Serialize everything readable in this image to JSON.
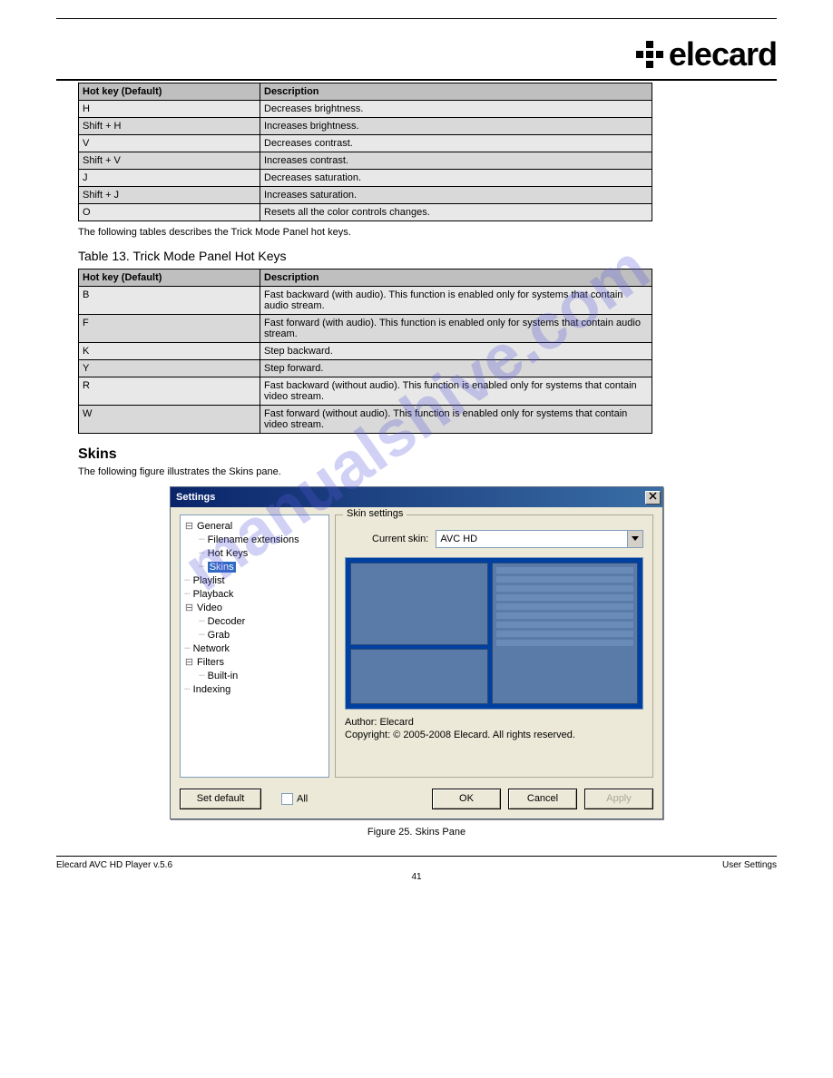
{
  "watermark": "manualshive.com",
  "logo_text": "elecard",
  "table1": {
    "headers": [
      "Hot key (Default)",
      "Description"
    ],
    "rows": [
      [
        "H",
        "Decreases brightness."
      ],
      [
        "Shift + H",
        "Increases brightness."
      ],
      [
        "V",
        "Decreases contrast."
      ],
      [
        "Shift + V",
        "Increases contrast."
      ],
      [
        "J",
        "Decreases saturation."
      ],
      [
        "Shift + J",
        "Increases saturation."
      ],
      [
        "O",
        "Resets all the color controls changes."
      ]
    ]
  },
  "note1": "The following tables describes the Trick Mode Panel hot keys.",
  "table2_title": "Table 13.    Trick Mode Panel Hot Keys",
  "table2": {
    "headers": [
      "Hot key (Default)",
      "Description"
    ],
    "rows": [
      [
        "B",
        "Fast backward (with audio). This function is enabled only for systems that contain audio stream."
      ],
      [
        "F",
        "Fast forward (with audio). This function is enabled only for systems that contain audio stream."
      ],
      [
        "K",
        "Step backward."
      ],
      [
        "Y",
        "Step forward."
      ],
      [
        "R",
        "Fast backward (without audio). This function is enabled only for systems that contain video stream."
      ],
      [
        "W",
        "Fast forward (without audio). This function is enabled only for systems that contain video stream."
      ]
    ]
  },
  "skins": {
    "heading": "Skins",
    "desc": "The following figure illustrates the Skins pane."
  },
  "dialog": {
    "title": "Settings",
    "tree": [
      {
        "label": "General",
        "expand": "-",
        "depth": 0
      },
      {
        "label": "Filename extensions",
        "depth": 1,
        "dots": true
      },
      {
        "label": "Hot Keys",
        "depth": 1,
        "dots": true
      },
      {
        "label": "Skins",
        "depth": 1,
        "dots": true,
        "selected": true
      },
      {
        "label": "Playlist",
        "depth": 0,
        "dots": true
      },
      {
        "label": "Playback",
        "depth": 0,
        "dots": true
      },
      {
        "label": "Video",
        "expand": "-",
        "depth": 0
      },
      {
        "label": "Decoder",
        "depth": 1,
        "dots": true
      },
      {
        "label": "Grab",
        "depth": 1,
        "dots": true
      },
      {
        "label": "Network",
        "depth": 0,
        "dots": true
      },
      {
        "label": "Filters",
        "expand": "-",
        "depth": 0
      },
      {
        "label": "Built-in",
        "depth": 1,
        "dots": true
      },
      {
        "label": "Indexing",
        "depth": 0,
        "dots": true
      }
    ],
    "fieldset_legend": "Skin settings",
    "current_skin_label": "Current skin:",
    "current_skin_value": "AVC HD",
    "author_label": "Author: Elecard",
    "copyright": "Copyright: © 2005-2008 Elecard. All rights reserved.",
    "set_default": "Set default",
    "all_label": "All",
    "ok": "OK",
    "cancel": "Cancel",
    "apply": "Apply"
  },
  "figure_caption": "Figure 25.    Skins Pane",
  "footer": {
    "left": "Elecard AVC HD Player v.5.6",
    "right": "User Settings"
  },
  "page_num": "41"
}
